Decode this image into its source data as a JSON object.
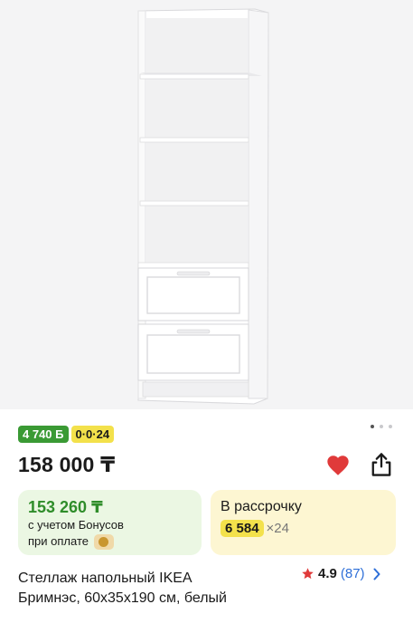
{
  "product": {
    "title_line1": "Стеллаж напольный IKEA",
    "title_line2": "Бримнэс, 60x35x190 см, белый",
    "price": "158 000 ₸",
    "rating": "4.9",
    "reviews": "(87)"
  },
  "badges": {
    "bonus": "4 740 Б",
    "installment": "0·0·24"
  },
  "bonus_card": {
    "price": "153 260 ₸",
    "note_line1": "с учетом Бонусов",
    "note_line2": "при оплате"
  },
  "installment_card": {
    "title": "В рассрочку",
    "amount": "6 584",
    "multiplier": "×24"
  },
  "gallery": {
    "dots": 3,
    "active_dot": 1
  },
  "colors": {
    "bonus_green": "#3a9a34",
    "accent_yellow": "#f3e14b",
    "heart_red": "#e03a3a",
    "link_blue": "#2e6fd8"
  }
}
